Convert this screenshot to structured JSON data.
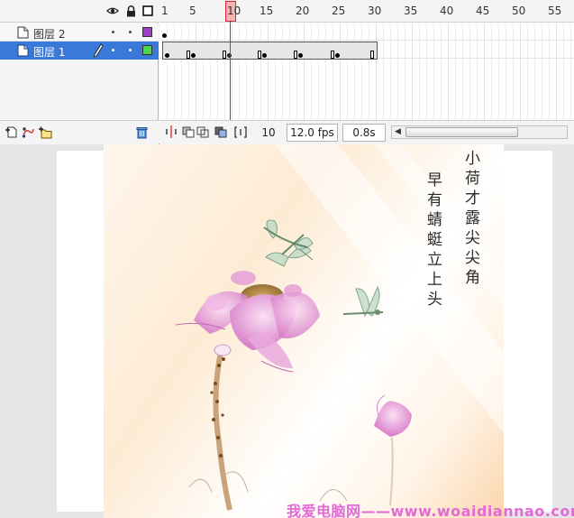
{
  "timeline": {
    "header_icons": [
      "eye-icon",
      "lock-icon",
      "outline-icon"
    ],
    "layers": [
      {
        "name": "图层 2",
        "outline_color": "#9b3fc6",
        "selected": false
      },
      {
        "name": "图层 1",
        "outline_color": "#46d84a",
        "selected": true
      }
    ],
    "ruler_labels": [
      "1",
      "5",
      "10",
      "15",
      "20",
      "25",
      "30",
      "35",
      "40",
      "45",
      "50",
      "55"
    ],
    "current_frame_label": "10",
    "footer": {
      "current_frame": "10",
      "frame_rate": "12.0 fps",
      "elapsed_time": "0.8s"
    }
  },
  "stage": {
    "poem_columns": [
      "小荷才露尖尖角",
      "早有蜻蜓立上头"
    ],
    "watermark": "我爱电脑网——www.woaidiannao.com"
  },
  "colors": {
    "selection": "#3b79d9",
    "playhead": "#d22222",
    "watermark": "#e36ad6"
  }
}
